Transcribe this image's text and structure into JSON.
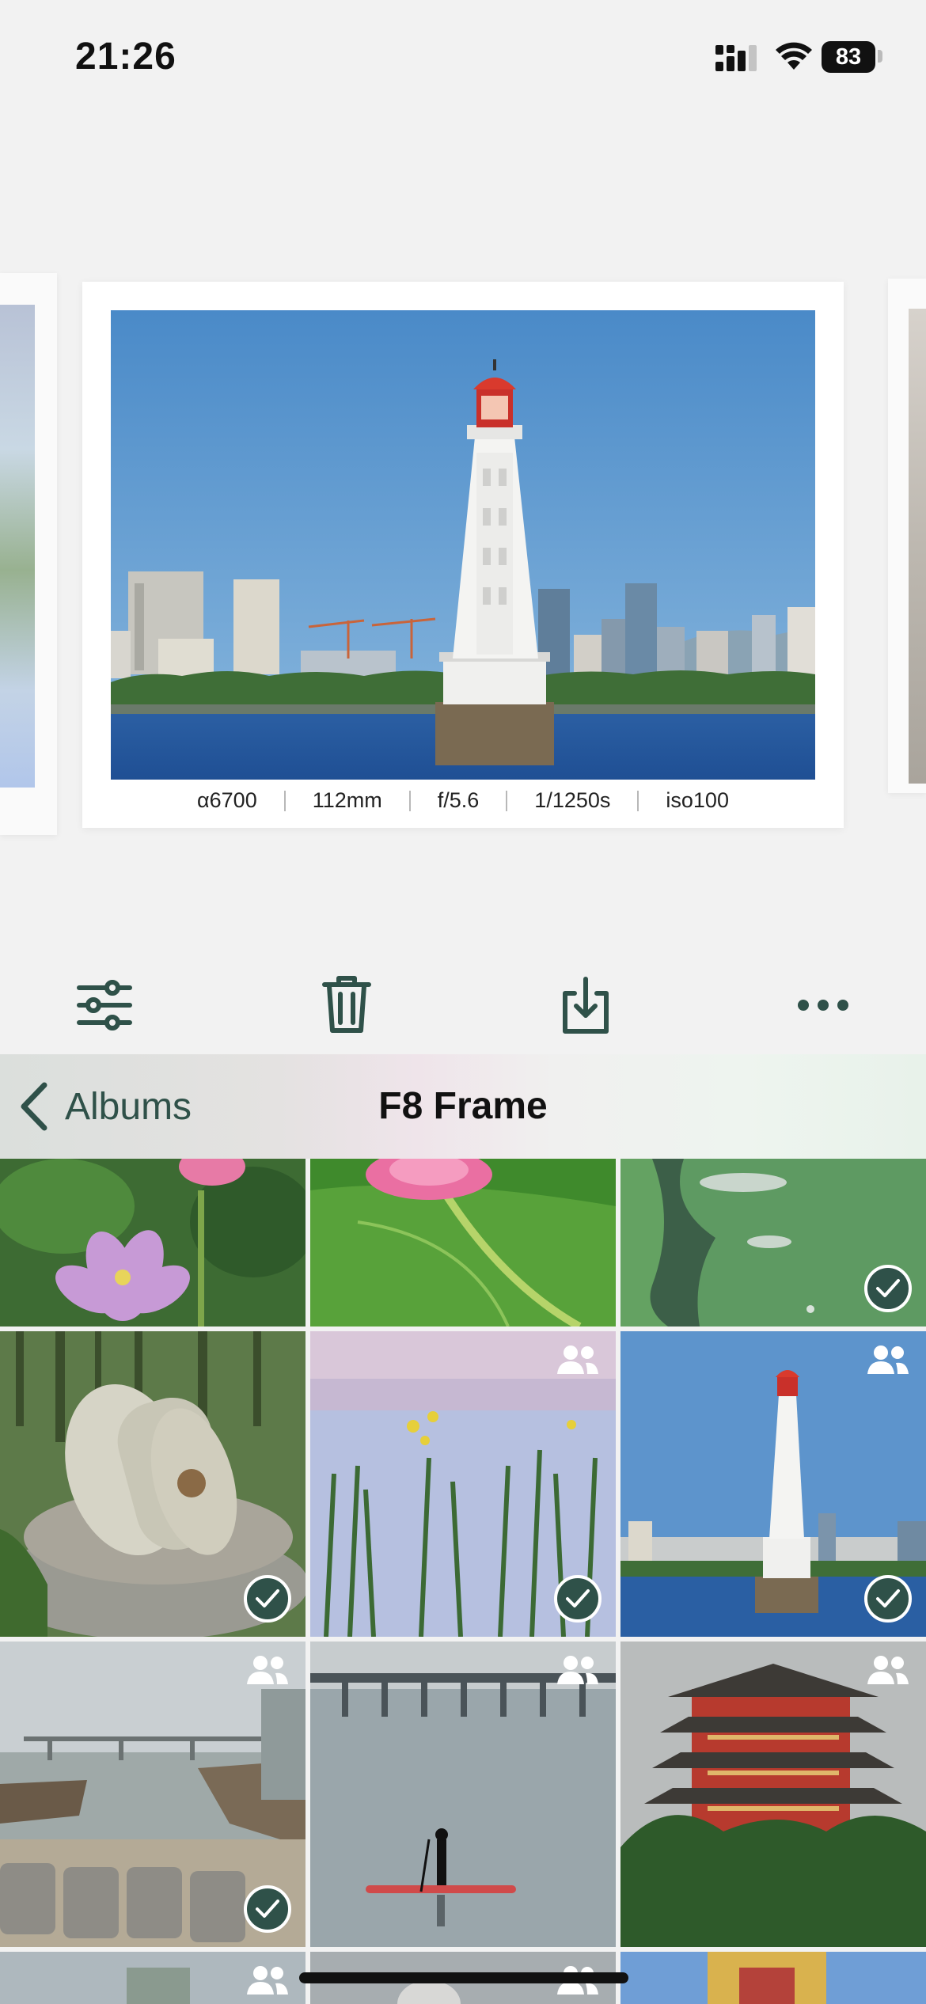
{
  "status_bar": {
    "time": "21:26",
    "battery": "83"
  },
  "preview": {
    "exif": {
      "camera": "α6700",
      "focal": "112mm",
      "aperture": "f/5.6",
      "shutter": "1/1250s",
      "iso": "iso100"
    }
  },
  "toolbar": {
    "icons": [
      "sliders-icon",
      "trash-icon",
      "download-icon",
      "more-icon"
    ]
  },
  "nav": {
    "back_label": "Albums",
    "title": "F8 Frame"
  },
  "colors": {
    "accent": "#2f5149",
    "background": "#f2f2f2"
  },
  "grid": {
    "items": [
      {
        "subject": "lotus",
        "selected": false,
        "shared": false
      },
      {
        "subject": "lotus-leaf",
        "selected": false,
        "shared": false
      },
      {
        "subject": "lotus-leaf-water",
        "selected": true,
        "shared": false
      },
      {
        "subject": "millstone",
        "selected": true,
        "shared": false
      },
      {
        "subject": "reeds",
        "selected": true,
        "shared": true
      },
      {
        "subject": "lighthouse",
        "selected": true,
        "shared": true
      },
      {
        "subject": "boats",
        "selected": true,
        "shared": true
      },
      {
        "subject": "paddleboard",
        "selected": false,
        "shared": true
      },
      {
        "subject": "pagoda",
        "selected": false,
        "shared": true
      },
      {
        "subject": "partial",
        "selected": false,
        "shared": true
      },
      {
        "subject": "partial",
        "selected": false,
        "shared": true
      },
      {
        "subject": "partial",
        "selected": false,
        "shared": false
      }
    ]
  }
}
